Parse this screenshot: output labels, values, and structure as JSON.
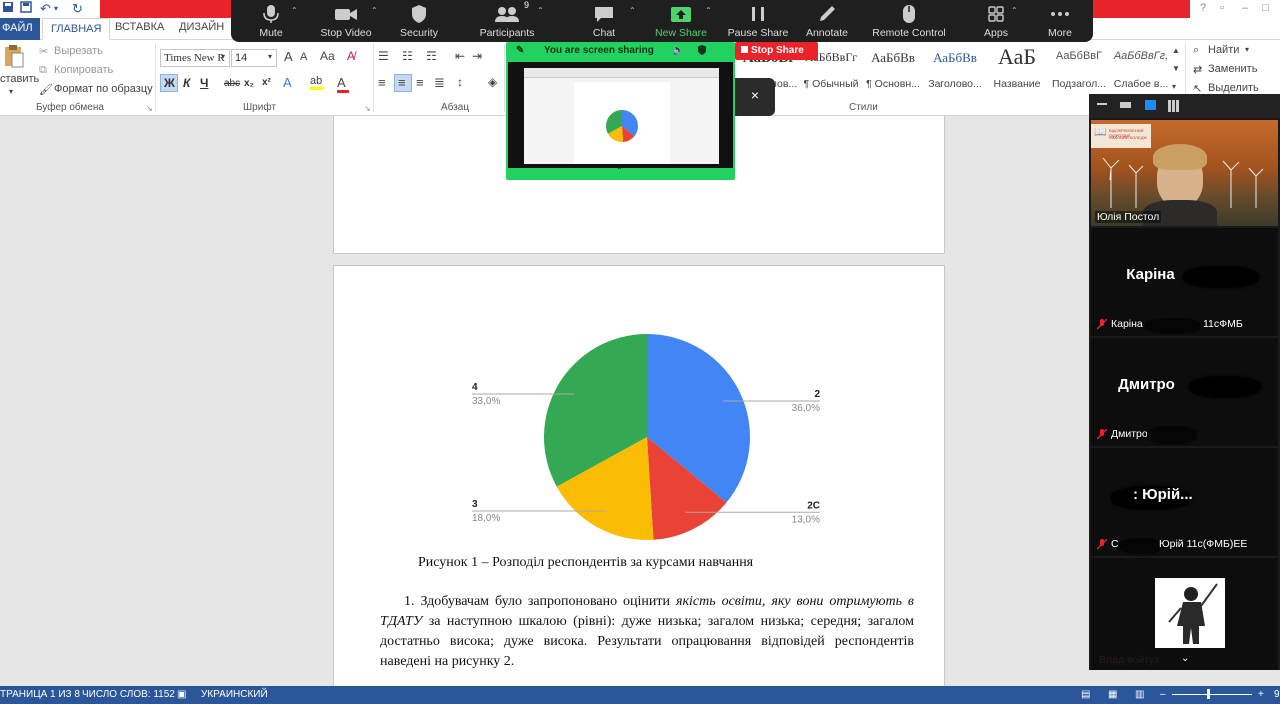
{
  "word": {
    "tabs": {
      "file": "ФАЙЛ",
      "home": "ГЛАВНАЯ",
      "insert": "ВСТАВКА",
      "design": "ДИЗАЙН"
    },
    "clipboard": {
      "paste": "ставить",
      "cut": "Вырезать",
      "copy": "Копировать",
      "format_painter": "Формат по образцу",
      "group_label": "Буфер обмена"
    },
    "font": {
      "name": "Times New R",
      "size": "14",
      "bold": "Ж",
      "italic": "К",
      "underline": "Ч",
      "strike": "abc",
      "sub": "x₂",
      "sup": "x²",
      "group_label": "Шрифт"
    },
    "paragraph": {
      "group_label": "Абзац"
    },
    "styles": {
      "group_label": "Стили",
      "items": [
        {
          "sample": "АаБбВг",
          "name": "¶ Заголов..."
        },
        {
          "sample": "АаБбВвГг",
          "name": "¶ Обычный"
        },
        {
          "sample": "АаБбВв",
          "name": "¶ Основн..."
        },
        {
          "sample": "АаБбВв",
          "name": "Заголово..."
        },
        {
          "sample": "АаБ",
          "name": "Название"
        },
        {
          "sample": "АаБбВвГ",
          "name": "Подзагол..."
        },
        {
          "sample": "АаБбВвГг,",
          "name": "Слабое в..."
        }
      ]
    },
    "editing": {
      "find": "Найти",
      "replace": "Заменить",
      "select": "Выделить"
    },
    "statusbar": {
      "page": "ТРАНИЦА 1 ИЗ 8",
      "words": "ЧИСЛО СЛОВ: 1152",
      "language": "УКРАИНСКИЙ",
      "zoom": "9"
    }
  },
  "document": {
    "caption": "Рисунок 1 – Розподіл респондентів за курсами навчання",
    "paragraph": {
      "p1": "1. Здобувачам було запропоновано оцінити ",
      "p2": "якість освіти, яку вони отримують в ТДАТУ",
      "p3": " за наступною шкалою (рівні): дуже низька; загалом низька; середня; загалом достатньо висока; дуже висока. Результати опрацювання відповідей респондентів наведені на рисунку 2."
    }
  },
  "chart_data": {
    "type": "pie",
    "title": "",
    "slices": [
      {
        "label": "2",
        "value": 36.0,
        "percent": "36,0%",
        "color": "#4285f4"
      },
      {
        "label": "2С",
        "value": 13.0,
        "percent": "13,0%",
        "color": "#ea4335"
      },
      {
        "label": "3",
        "value": 18.0,
        "percent": "18,0%",
        "color": "#fbbc04"
      },
      {
        "label": "4",
        "value": 33.0,
        "percent": "33,0%",
        "color": "#34a853"
      }
    ]
  },
  "zoom": {
    "toolbar": [
      {
        "label": "Mute",
        "icon": "microphone-icon"
      },
      {
        "label": "Stop Video",
        "icon": "video-camera-icon"
      },
      {
        "label": "Security",
        "icon": "shield-icon"
      },
      {
        "label": "Participants",
        "icon": "participants-icon",
        "count": "9"
      },
      {
        "label": "Chat",
        "icon": "chat-bubble-icon"
      },
      {
        "label": "New Share",
        "icon": "share-arrow-icon"
      },
      {
        "label": "Pause Share",
        "icon": "pause-icon"
      },
      {
        "label": "Annotate",
        "icon": "pencil-icon"
      },
      {
        "label": "Remote Control",
        "icon": "mouse-icon"
      },
      {
        "label": "Apps",
        "icon": "apps-icon"
      },
      {
        "label": "More",
        "icon": "more-dots-icon"
      }
    ],
    "sharing_text": "You are screen sharing",
    "stop_share": "Stop Share",
    "close": "×",
    "colors": {
      "toolbar_bg": "#1f1f1f",
      "share_green": "#23d160",
      "stop_red": "#e8242a"
    }
  },
  "participants": [
    {
      "big": "",
      "label": "Юлія Постол",
      "video": true
    },
    {
      "big": "Каріна",
      "label": "Каріна",
      "suffix": "11сФМБ",
      "muted": true
    },
    {
      "big": "Дмитро",
      "label": "Дмитро",
      "suffix": "",
      "muted": true
    },
    {
      "big": ": Юрій...",
      "label": "С",
      "suffix": "Юрій 11с(ФМБ)ЕЕ",
      "muted": true
    },
    {
      "big": "",
      "label": "Влад  войтух",
      "video": true
    }
  ],
  "presenter_banner": {
    "line1": "ВІДОКРЕМЛЕНИЙ ПІДРОЗДІЛ",
    "line2": "ФАХОВИЙ КОЛЕДЖ"
  }
}
